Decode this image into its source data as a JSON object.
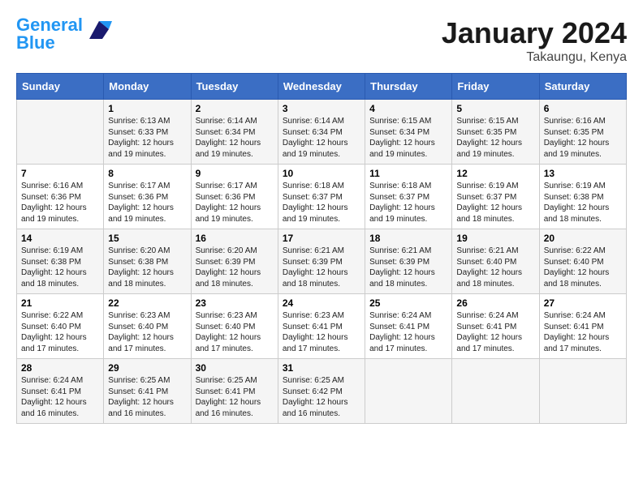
{
  "header": {
    "logo_line1": "General",
    "logo_line2": "Blue",
    "month": "January 2024",
    "location": "Takaungu, Kenya"
  },
  "columns": [
    "Sunday",
    "Monday",
    "Tuesday",
    "Wednesday",
    "Thursday",
    "Friday",
    "Saturday"
  ],
  "weeks": [
    [
      {
        "day": "",
        "info": ""
      },
      {
        "day": "1",
        "info": "Sunrise: 6:13 AM\nSunset: 6:33 PM\nDaylight: 12 hours\nand 19 minutes."
      },
      {
        "day": "2",
        "info": "Sunrise: 6:14 AM\nSunset: 6:34 PM\nDaylight: 12 hours\nand 19 minutes."
      },
      {
        "day": "3",
        "info": "Sunrise: 6:14 AM\nSunset: 6:34 PM\nDaylight: 12 hours\nand 19 minutes."
      },
      {
        "day": "4",
        "info": "Sunrise: 6:15 AM\nSunset: 6:34 PM\nDaylight: 12 hours\nand 19 minutes."
      },
      {
        "day": "5",
        "info": "Sunrise: 6:15 AM\nSunset: 6:35 PM\nDaylight: 12 hours\nand 19 minutes."
      },
      {
        "day": "6",
        "info": "Sunrise: 6:16 AM\nSunset: 6:35 PM\nDaylight: 12 hours\nand 19 minutes."
      }
    ],
    [
      {
        "day": "7",
        "info": "Sunrise: 6:16 AM\nSunset: 6:36 PM\nDaylight: 12 hours\nand 19 minutes."
      },
      {
        "day": "8",
        "info": "Sunrise: 6:17 AM\nSunset: 6:36 PM\nDaylight: 12 hours\nand 19 minutes."
      },
      {
        "day": "9",
        "info": "Sunrise: 6:17 AM\nSunset: 6:36 PM\nDaylight: 12 hours\nand 19 minutes."
      },
      {
        "day": "10",
        "info": "Sunrise: 6:18 AM\nSunset: 6:37 PM\nDaylight: 12 hours\nand 19 minutes."
      },
      {
        "day": "11",
        "info": "Sunrise: 6:18 AM\nSunset: 6:37 PM\nDaylight: 12 hours\nand 19 minutes."
      },
      {
        "day": "12",
        "info": "Sunrise: 6:19 AM\nSunset: 6:37 PM\nDaylight: 12 hours\nand 18 minutes."
      },
      {
        "day": "13",
        "info": "Sunrise: 6:19 AM\nSunset: 6:38 PM\nDaylight: 12 hours\nand 18 minutes."
      }
    ],
    [
      {
        "day": "14",
        "info": "Sunrise: 6:19 AM\nSunset: 6:38 PM\nDaylight: 12 hours\nand 18 minutes."
      },
      {
        "day": "15",
        "info": "Sunrise: 6:20 AM\nSunset: 6:38 PM\nDaylight: 12 hours\nand 18 minutes."
      },
      {
        "day": "16",
        "info": "Sunrise: 6:20 AM\nSunset: 6:39 PM\nDaylight: 12 hours\nand 18 minutes."
      },
      {
        "day": "17",
        "info": "Sunrise: 6:21 AM\nSunset: 6:39 PM\nDaylight: 12 hours\nand 18 minutes."
      },
      {
        "day": "18",
        "info": "Sunrise: 6:21 AM\nSunset: 6:39 PM\nDaylight: 12 hours\nand 18 minutes."
      },
      {
        "day": "19",
        "info": "Sunrise: 6:21 AM\nSunset: 6:40 PM\nDaylight: 12 hours\nand 18 minutes."
      },
      {
        "day": "20",
        "info": "Sunrise: 6:22 AM\nSunset: 6:40 PM\nDaylight: 12 hours\nand 18 minutes."
      }
    ],
    [
      {
        "day": "21",
        "info": "Sunrise: 6:22 AM\nSunset: 6:40 PM\nDaylight: 12 hours\nand 17 minutes."
      },
      {
        "day": "22",
        "info": "Sunrise: 6:23 AM\nSunset: 6:40 PM\nDaylight: 12 hours\nand 17 minutes."
      },
      {
        "day": "23",
        "info": "Sunrise: 6:23 AM\nSunset: 6:40 PM\nDaylight: 12 hours\nand 17 minutes."
      },
      {
        "day": "24",
        "info": "Sunrise: 6:23 AM\nSunset: 6:41 PM\nDaylight: 12 hours\nand 17 minutes."
      },
      {
        "day": "25",
        "info": "Sunrise: 6:24 AM\nSunset: 6:41 PM\nDaylight: 12 hours\nand 17 minutes."
      },
      {
        "day": "26",
        "info": "Sunrise: 6:24 AM\nSunset: 6:41 PM\nDaylight: 12 hours\nand 17 minutes."
      },
      {
        "day": "27",
        "info": "Sunrise: 6:24 AM\nSunset: 6:41 PM\nDaylight: 12 hours\nand 17 minutes."
      }
    ],
    [
      {
        "day": "28",
        "info": "Sunrise: 6:24 AM\nSunset: 6:41 PM\nDaylight: 12 hours\nand 16 minutes."
      },
      {
        "day": "29",
        "info": "Sunrise: 6:25 AM\nSunset: 6:41 PM\nDaylight: 12 hours\nand 16 minutes."
      },
      {
        "day": "30",
        "info": "Sunrise: 6:25 AM\nSunset: 6:41 PM\nDaylight: 12 hours\nand 16 minutes."
      },
      {
        "day": "31",
        "info": "Sunrise: 6:25 AM\nSunset: 6:42 PM\nDaylight: 12 hours\nand 16 minutes."
      },
      {
        "day": "",
        "info": ""
      },
      {
        "day": "",
        "info": ""
      },
      {
        "day": "",
        "info": ""
      }
    ]
  ]
}
